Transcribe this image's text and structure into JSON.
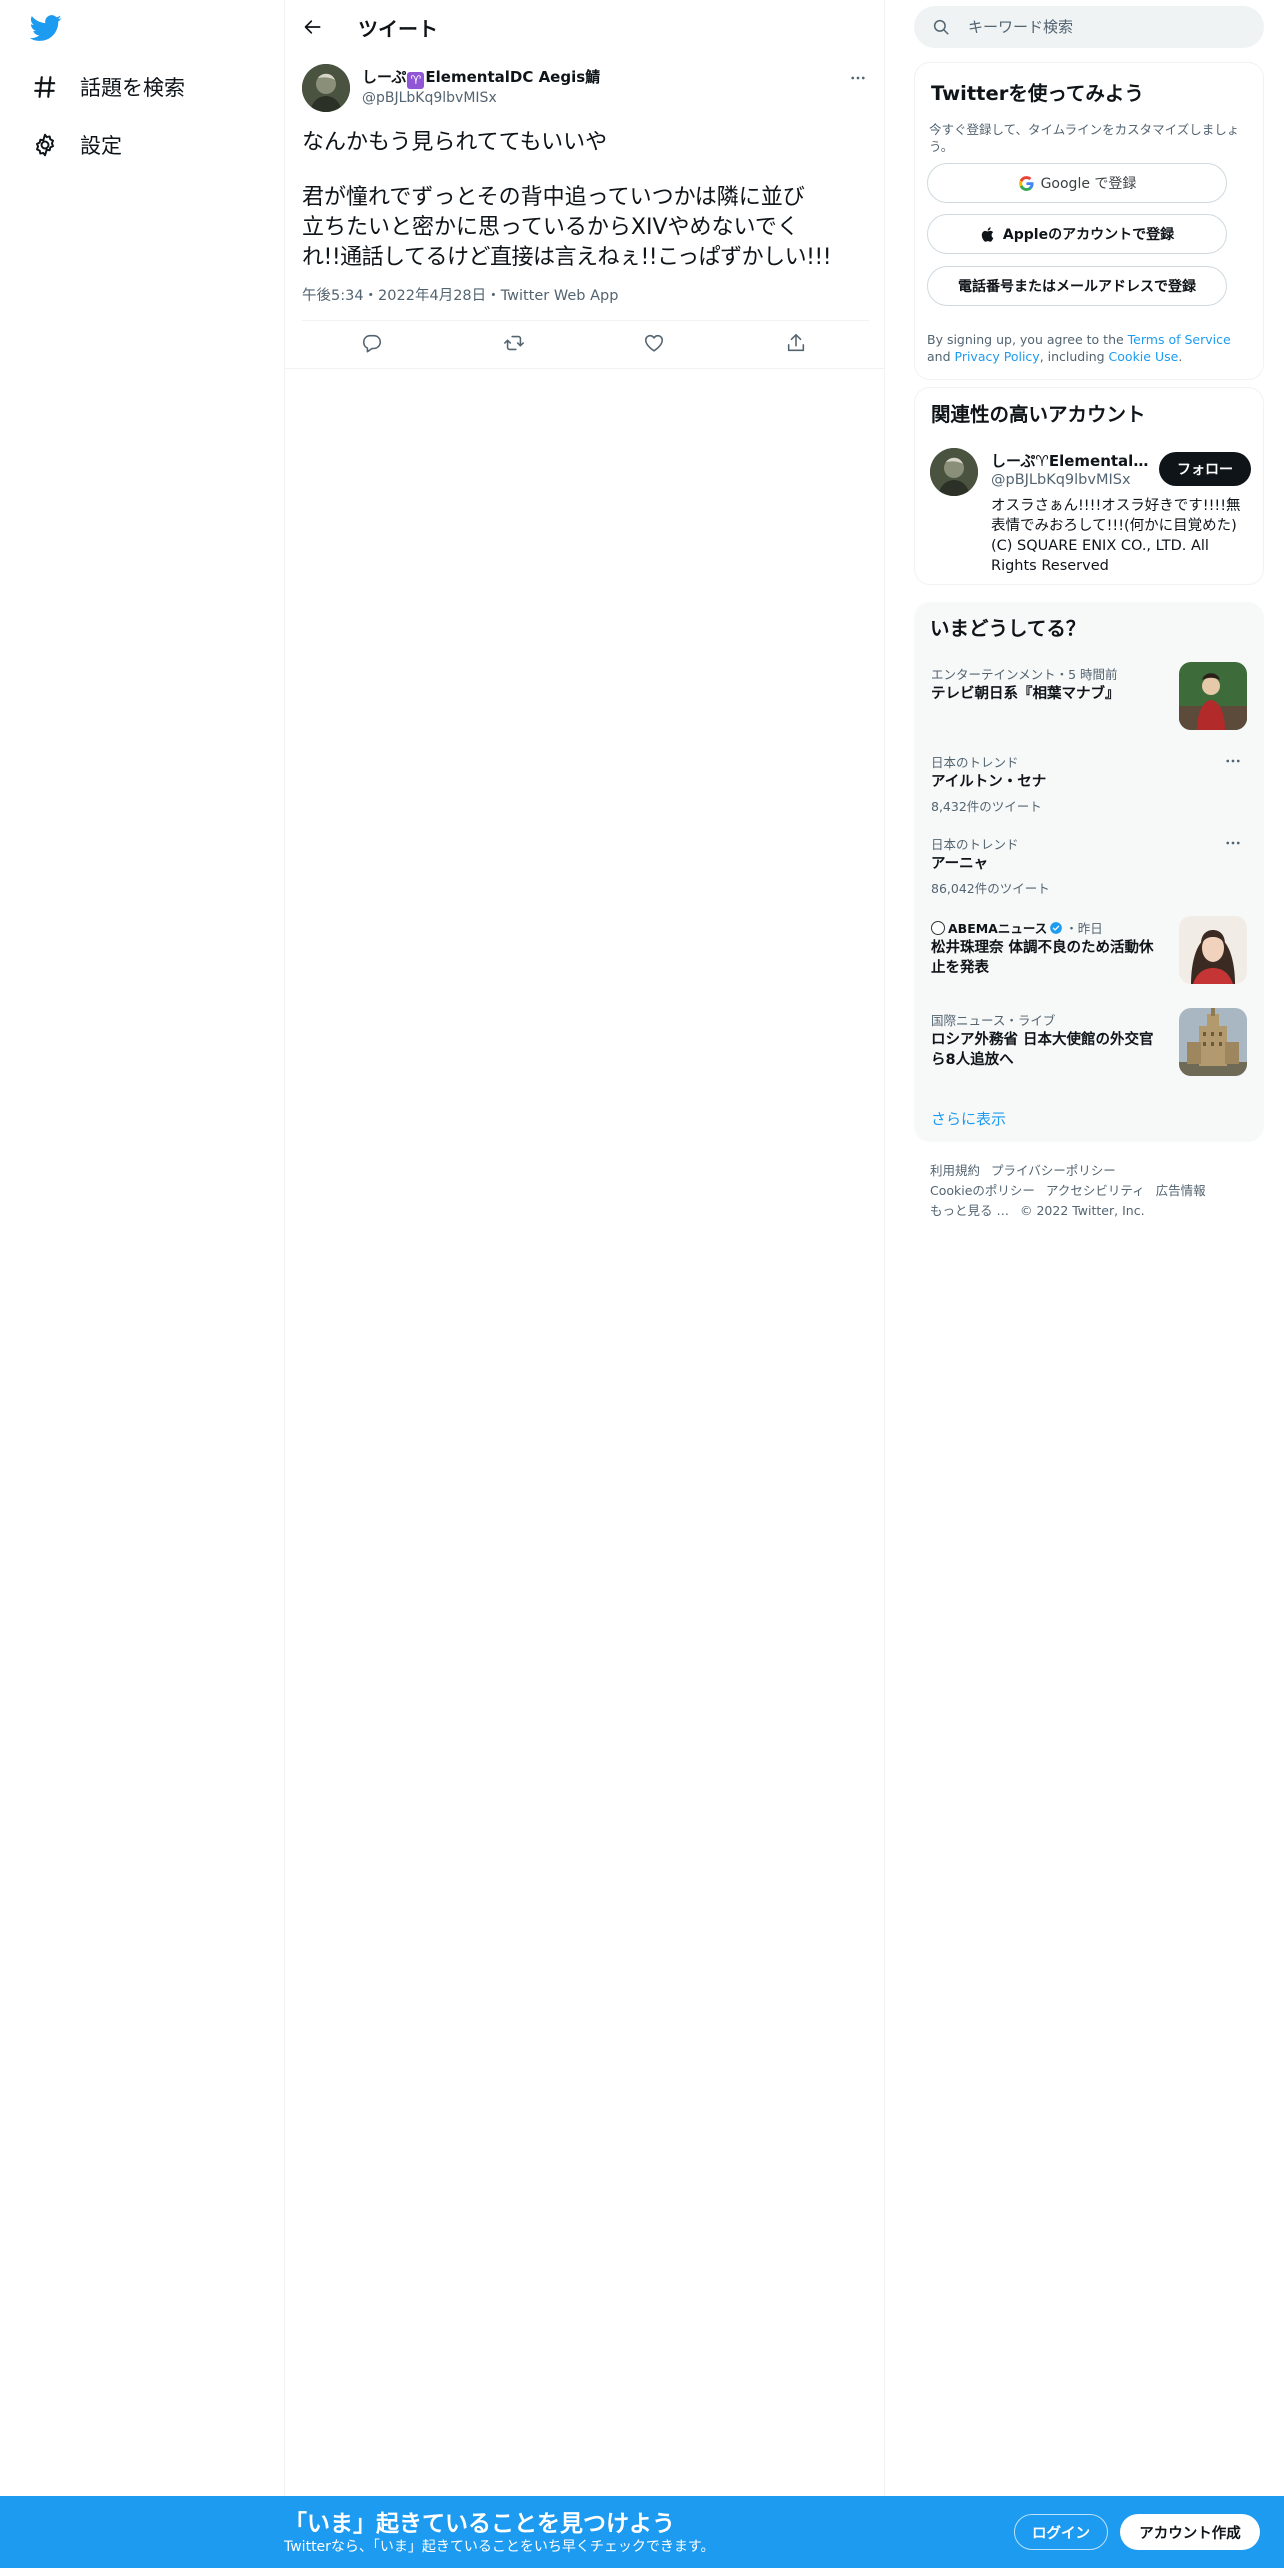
{
  "nav": {
    "items": [
      {
        "label": "話題を検索",
        "icon": "hashtag-icon"
      },
      {
        "label": "設定",
        "icon": "gear-icon"
      }
    ]
  },
  "header": {
    "title": "ツイート"
  },
  "tweet": {
    "author_name_prefix": "しーぷ",
    "author_name_symbol": "♈",
    "author_name_suffix": "ElementalDC Aegis鯖",
    "author_handle": "@pBJLbKq9lbvMISx",
    "text_line_1": "なんかもう見られててもいいや",
    "text_line_2": "君が憧れでずっとその背中追っていつかは隣に並び",
    "text_line_3": "立ちたいと密かに思っているからXIVやめないでく",
    "text_line_4": "れ!!通話してるけど直接は言えねぇ!!こっぱずかしい!!!",
    "meta": "午後5:34・2022年4月28日・Twitter Web App"
  },
  "search": {
    "placeholder": "キーワード検索"
  },
  "signup": {
    "title": "Twitterを使ってみよう",
    "description": "今すぐ登録して、タイムラインをカスタマイズしましょう。",
    "google_label": "Google で登録",
    "apple_label": "Appleのアカウントで登録",
    "phone_label": "電話番号またはメールアドレスで登録",
    "legal_1": "By signing up, you agree to the ",
    "legal_tos": "Terms of Service",
    "legal_2": " and ",
    "legal_privacy": "Privacy Policy",
    "legal_3": ", including ",
    "legal_cookie": "Cookie Use",
    "legal_4": "."
  },
  "related": {
    "title": "関連性の高いアカウント",
    "name": "しーぷ♈ElementalDC Aegis鯖",
    "handle": "@pBJLbKq9lbvMISx",
    "bio": "オスラさぁん!!!!オスラ好きです!!!!無表情でみおろして!!!(何かに目覚めた) (C) SQUARE ENIX CO., LTD. All Rights Reserved",
    "follow_label": "フォロー"
  },
  "trends": {
    "title": "いまどうしてる？",
    "items": [
      {
        "meta": "エンターテインメント・5 時間前",
        "title": "テレビ朝日系『相葉マナブ』",
        "count": ""
      },
      {
        "meta": "日本のトレンド",
        "title": "アイルトン・セナ",
        "count": "8,432件のツイート"
      },
      {
        "meta": "日本のトレンド",
        "title": "アーニャ",
        "count": "86,042件のツイート"
      },
      {
        "meta_source": "ABEMAニュース",
        "meta_time": "・昨日",
        "title": "松井珠理奈 体調不良のため活動休止を発表",
        "count": ""
      },
      {
        "meta": "国際ニュース・ライブ",
        "title": "ロシア外務省 日本大使館の外交官ら8人追放へ",
        "count": ""
      }
    ],
    "show_more": "さらに表示"
  },
  "footer": {
    "row1": [
      "利用規約",
      "プライバシーポリシー"
    ],
    "row2": [
      "Cookieのポリシー",
      "アクセシビリティ",
      "広告情報"
    ],
    "row3": [
      "もっと見る …",
      "© 2022 Twitter, Inc."
    ]
  },
  "bottom_bar": {
    "title": "「いま」起きていることを見つけよう",
    "subtitle": "Twitterなら、「いま」起きていることをいち早くチェックできます。",
    "login_label": "ログイン",
    "signup_label": "アカウント作成"
  },
  "colors": {
    "accent": "#1d9bf0",
    "text": "#0f1419",
    "secondary": "#536471",
    "border": "#eff3f4"
  }
}
